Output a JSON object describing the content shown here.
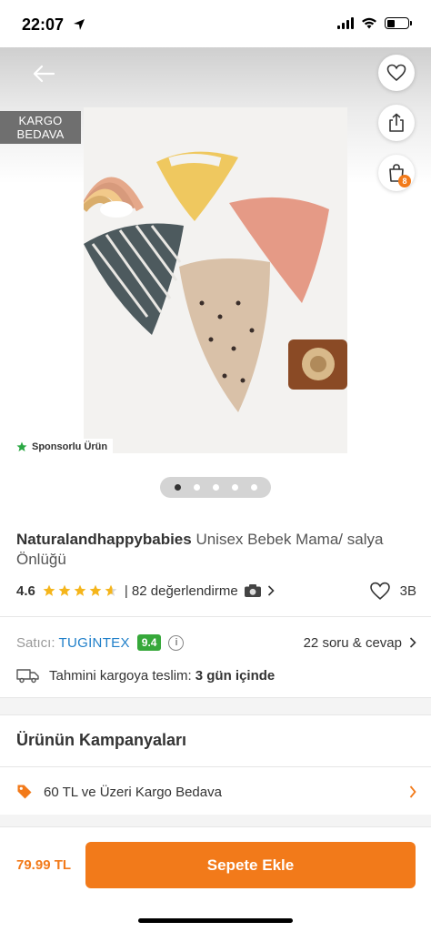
{
  "status_bar": {
    "time": "22:07"
  },
  "hero": {
    "cargo_badge_line1": "KARGO",
    "cargo_badge_line2": "BEDAVA",
    "cart_count": "8",
    "sponsored_label": "Sponsorlu Ürün",
    "image_description": null,
    "carousel": {
      "total": 5,
      "active_index": 0
    }
  },
  "product": {
    "brand": "Naturalandhappybabies",
    "name": "Unisex Bebek Mama/ salya Önlüğü",
    "rating": "4.6",
    "stars_value": 4.6,
    "review_count": "| 82 değerlendirme",
    "favorites": "3B"
  },
  "seller": {
    "label": "Satıcı:",
    "name": "TUGİNTEX",
    "score": "9.4",
    "info_symbol": "i",
    "qa_link": "22 soru & cevap"
  },
  "delivery": {
    "text": "Tahmini kargoya teslim:",
    "time": "3 gün içinde"
  },
  "campaigns": {
    "title": "Ürünün Kampanyaları",
    "items": [
      {
        "label": "60 TL ve Üzeri Kargo Bedava"
      }
    ]
  },
  "bottom_bar": {
    "price": "79.99 TL",
    "add_to_cart": "Sepete Ekle"
  },
  "colors": {
    "accent": "#f27a1a",
    "seller_link": "#1f7fc9",
    "score_green": "#36a83a",
    "star": "#f5b51b"
  },
  "icons": [
    "back-arrow-icon",
    "heart-icon",
    "share-icon",
    "cart-icon",
    "star-icon",
    "camera-icon",
    "chevron-right-icon",
    "info-icon",
    "truck-icon",
    "tag-icon"
  ]
}
